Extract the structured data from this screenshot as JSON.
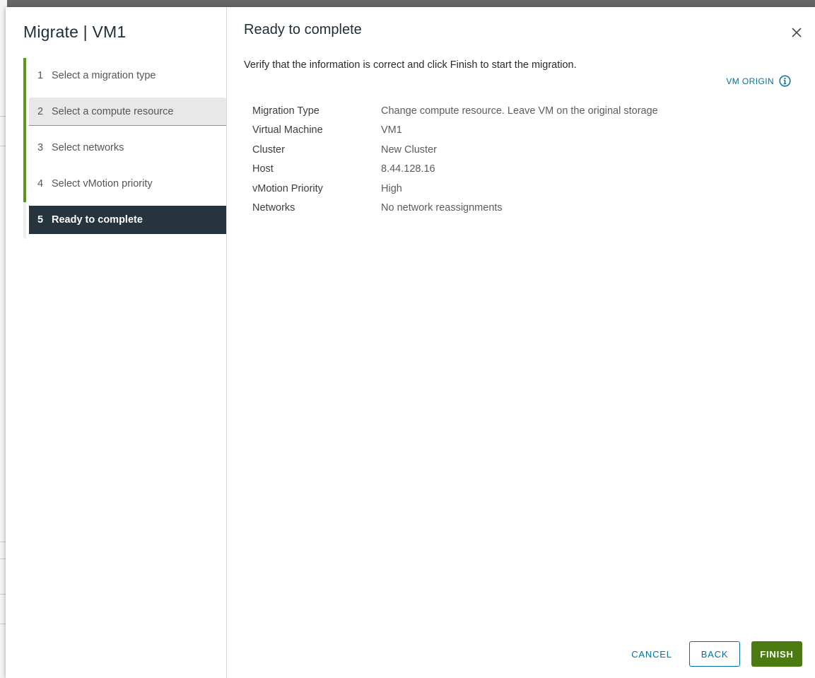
{
  "dialog": {
    "title": "Migrate | VM1",
    "steps": [
      {
        "num": "1",
        "label": "Select a migration type"
      },
      {
        "num": "2",
        "label": "Select a compute resource"
      },
      {
        "num": "3",
        "label": "Select networks"
      },
      {
        "num": "4",
        "label": "Select vMotion priority"
      },
      {
        "num": "5",
        "label": "Ready to complete"
      }
    ]
  },
  "main": {
    "title": "Ready to complete",
    "description": "Verify that the information is correct and click Finish to start the migration.",
    "vm_origin_label": "VM ORIGIN",
    "summary": [
      {
        "key": "Migration Type",
        "value": "Change compute resource. Leave VM on the original storage"
      },
      {
        "key": "Virtual Machine",
        "value": "VM1"
      },
      {
        "key": "Cluster",
        "value": "New Cluster"
      },
      {
        "key": "Host",
        "value": "8.44.128.16"
      },
      {
        "key": "vMotion Priority",
        "value": "High"
      },
      {
        "key": "Networks",
        "value": "No network reassignments"
      }
    ]
  },
  "footer": {
    "cancel_label": "CANCEL",
    "back_label": "BACK",
    "finish_label": "FINISH"
  },
  "colors": {
    "accent_green": "#5a9a19",
    "active_step_bg": "#25343d",
    "link_blue": "#0072a3",
    "finish_green": "#4a7a10"
  },
  "icons": {
    "close": "close-icon",
    "info": "info-icon"
  }
}
